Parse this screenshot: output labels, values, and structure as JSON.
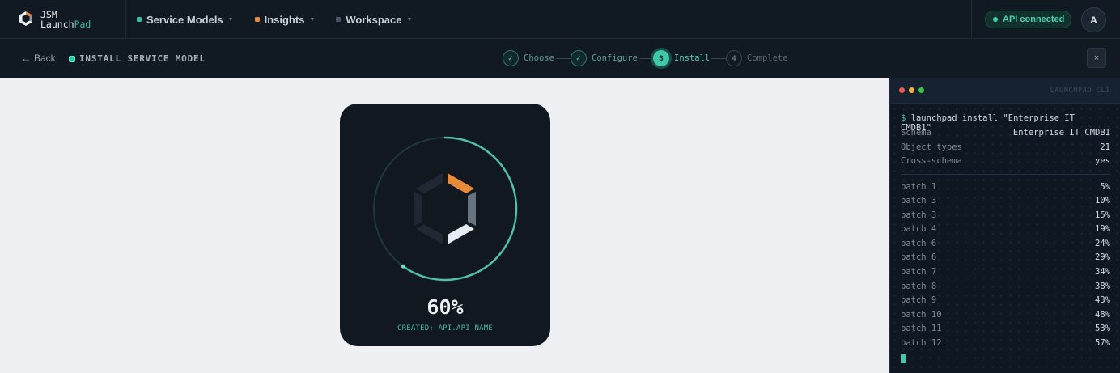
{
  "brand": {
    "line1": "JSM",
    "line2_a": "Launch",
    "line2_b": "Pad"
  },
  "nav": {
    "items": [
      {
        "label": "Service Models",
        "color": "#2fc0a3"
      },
      {
        "label": "Insights",
        "color": "#e88a3b"
      },
      {
        "label": "Workspace",
        "color": "#4a5567"
      }
    ]
  },
  "status": {
    "api": "API connected"
  },
  "user": {
    "initial": "A"
  },
  "subbar": {
    "back": "Back",
    "title": "INSTALL SERVICE MODEL",
    "close": "×"
  },
  "steps": [
    {
      "marker": "✓",
      "label": "Choose",
      "state": "done"
    },
    {
      "marker": "✓",
      "label": "Configure",
      "state": "done"
    },
    {
      "marker": "3",
      "label": "Install",
      "state": "active"
    },
    {
      "marker": "4",
      "label": "Complete",
      "state": "todo"
    }
  ],
  "progress": {
    "percent_label": "60%",
    "value": 0.6,
    "caption": "CREATED: API.API NAME"
  },
  "terminal": {
    "title": "LAUNCHPAD CLI",
    "prompt": "$",
    "command": "launchpad install \"Enterprise IT CMDB1\"",
    "summary": [
      {
        "key": "Schema",
        "value": "Enterprise IT CMDB1"
      },
      {
        "key": "Object types",
        "value": "21"
      },
      {
        "key": "Cross-schema",
        "value": "yes"
      }
    ],
    "batches": [
      {
        "name": "batch 1",
        "pct": "5%"
      },
      {
        "name": "batch 3",
        "pct": "10%"
      },
      {
        "name": "batch 3",
        "pct": "15%"
      },
      {
        "name": "batch 4",
        "pct": "19%"
      },
      {
        "name": "batch 6",
        "pct": "24%"
      },
      {
        "name": "batch 6",
        "pct": "29%"
      },
      {
        "name": "batch 7",
        "pct": "34%"
      },
      {
        "name": "batch 8",
        "pct": "38%"
      },
      {
        "name": "batch 9",
        "pct": "43%"
      },
      {
        "name": "batch 10",
        "pct": "48%"
      },
      {
        "name": "batch 11",
        "pct": "53%"
      },
      {
        "name": "batch 12",
        "pct": "57%"
      }
    ]
  },
  "colors": {
    "accent": "#3ec8a8",
    "orange": "#e88a3b"
  }
}
